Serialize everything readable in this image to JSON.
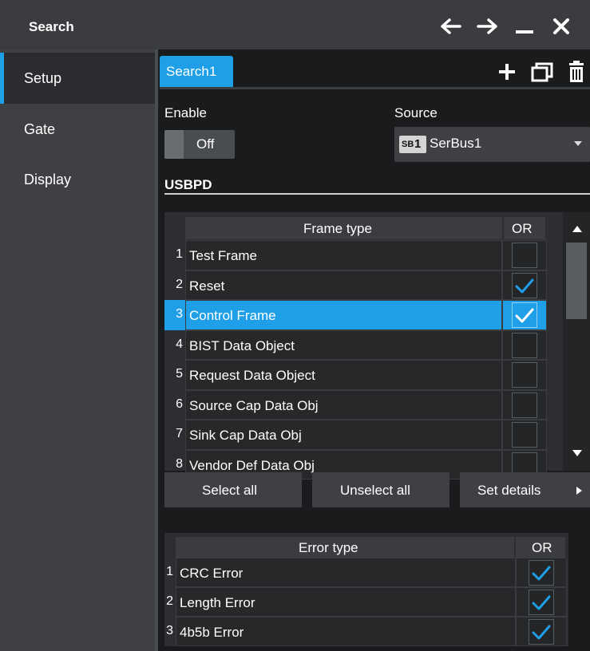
{
  "window": {
    "title": "Search"
  },
  "sidebar": {
    "items": [
      {
        "label": "Setup",
        "active": true
      },
      {
        "label": "Gate",
        "active": false
      },
      {
        "label": "Display",
        "active": false
      }
    ]
  },
  "tabs": {
    "active_label": "Search1"
  },
  "enable": {
    "label": "Enable",
    "value": "Off"
  },
  "source": {
    "label": "Source",
    "badge_prefix": "SB",
    "badge_num": "1",
    "value": "SerBus1"
  },
  "protocol": {
    "label": "USBPD"
  },
  "frame_table": {
    "header_name": "Frame type",
    "header_or": "OR",
    "rows": [
      {
        "num": "1",
        "name": "Test Frame",
        "checked": false
      },
      {
        "num": "2",
        "name": "Reset",
        "checked": true
      },
      {
        "num": "3",
        "name": "Control Frame",
        "checked": true,
        "selected": true
      },
      {
        "num": "4",
        "name": "BIST Data Object",
        "checked": false
      },
      {
        "num": "5",
        "name": "Request Data Object",
        "checked": false
      },
      {
        "num": "6",
        "name": "Source Cap Data Obj",
        "checked": false
      },
      {
        "num": "7",
        "name": "Sink Cap Data Obj",
        "checked": false
      },
      {
        "num": "8",
        "name": "Vendor Def Data Obj",
        "checked": false
      }
    ]
  },
  "buttons": {
    "select_all": "Select all",
    "unselect_all": "Unselect all",
    "set_details": "Set details"
  },
  "error_table": {
    "header_name": "Error type",
    "header_or": "OR",
    "rows": [
      {
        "num": "1",
        "name": "CRC Error",
        "checked": true
      },
      {
        "num": "2",
        "name": "Length Error",
        "checked": true
      },
      {
        "num": "3",
        "name": "4b5b Error",
        "checked": true
      }
    ]
  },
  "colors": {
    "accent": "#1f9fe8",
    "panel": "#3e4043",
    "background": "#1a1b1d"
  }
}
